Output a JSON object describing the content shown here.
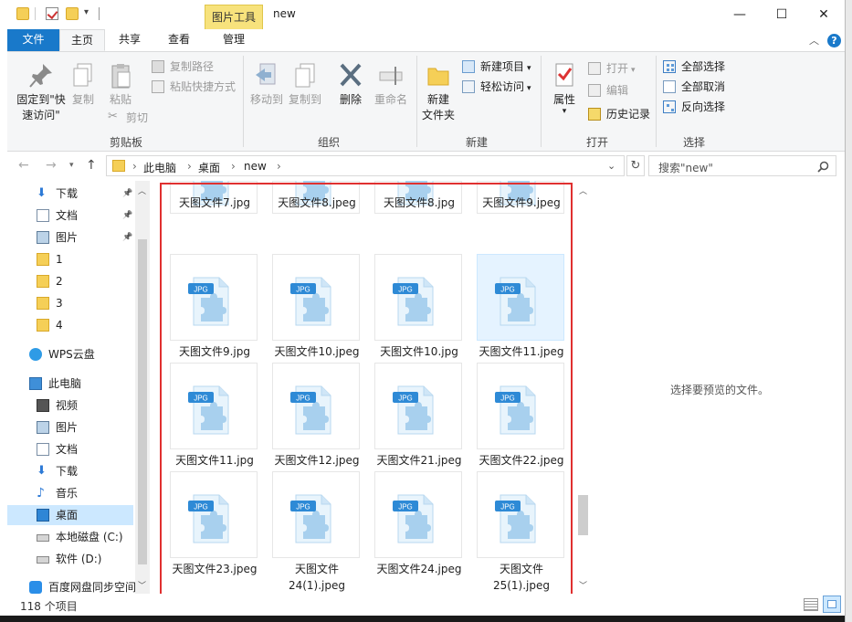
{
  "window": {
    "title": "new",
    "context_tab": "图片工具",
    "minimize": "—",
    "maximize": "☐",
    "close": "✕"
  },
  "tabs": {
    "file": "文件",
    "home": "主页",
    "share": "共享",
    "view": "查看",
    "manage": "管理"
  },
  "ribbon": {
    "pin_quick": "固定到\"快",
    "pin_quick2": "速访问\"",
    "copy": "复制",
    "paste": "粘贴",
    "copy_path": "复制路径",
    "paste_shortcut": "粘贴快捷方式",
    "cut": "剪切",
    "clipboard_label": "剪贴板",
    "move_to": "移动到",
    "copy_to": "复制到",
    "delete": "删除",
    "rename": "重命名",
    "organize_label": "组织",
    "new_folder": "新建",
    "new_folder2": "文件夹",
    "new_item": "新建项目",
    "easy_access": "轻松访问",
    "new_label": "新建",
    "properties": "属性",
    "open": "打开",
    "edit": "编辑",
    "history": "历史记录",
    "open_label": "打开",
    "select_all": "全部选择",
    "select_none": "全部取消",
    "invert": "反向选择",
    "select_label": "选择"
  },
  "address": {
    "crumb1": "此电脑",
    "crumb2": "桌面",
    "crumb3": "new",
    "search_placeholder": "搜索\"new\""
  },
  "nav": {
    "items": [
      {
        "label": "下载",
        "icon": "download-icon"
      },
      {
        "label": "文档",
        "icon": "document-icon"
      },
      {
        "label": "图片",
        "icon": "picture-icon"
      },
      {
        "label": "1",
        "icon": "folder-icon"
      },
      {
        "label": "2",
        "icon": "folder-icon"
      },
      {
        "label": "3",
        "icon": "folder-icon"
      },
      {
        "label": "4",
        "icon": "folder-icon"
      },
      {
        "label": "WPS云盘",
        "icon": "cloud-icon"
      },
      {
        "label": "此电脑",
        "icon": "computer-icon"
      },
      {
        "label": "视频",
        "icon": "video-icon"
      },
      {
        "label": "图片",
        "icon": "picture-icon"
      },
      {
        "label": "文档",
        "icon": "document-icon"
      },
      {
        "label": "下载",
        "icon": "download-icon"
      },
      {
        "label": "音乐",
        "icon": "music-icon"
      },
      {
        "label": "桌面",
        "icon": "desktop-icon"
      },
      {
        "label": "本地磁盘 (C:)",
        "icon": "drive-icon"
      },
      {
        "label": "软件 (D:)",
        "icon": "drive-icon"
      },
      {
        "label": "百度网盘同步空间",
        "icon": "baidu-icon"
      }
    ]
  },
  "files": [
    {
      "name": "天图文件7.jpg"
    },
    {
      "name": "天图文件8.jpeg"
    },
    {
      "name": "天图文件8.jpg"
    },
    {
      "name": "天图文件9.jpeg"
    },
    {
      "name": "天图文件9.jpg"
    },
    {
      "name": "天图文件10.jpeg"
    },
    {
      "name": "天图文件10.jpg"
    },
    {
      "name": "天图文件11.jpeg"
    },
    {
      "name": "天图文件11.jpg"
    },
    {
      "name": "天图文件12.jpeg"
    },
    {
      "name": "天图文件21.jpeg"
    },
    {
      "name": "天图文件22.jpeg"
    },
    {
      "name": "天图文件23.jpeg"
    },
    {
      "name": "天图文件",
      "name2": "24(1).jpeg"
    },
    {
      "name": "天图文件24.jpeg"
    },
    {
      "name": "天图文件",
      "name2": "25(1).jpeg"
    }
  ],
  "jpg_badge": "JPG",
  "preview": {
    "message": "选择要预览的文件。"
  },
  "status": {
    "count": "118 个项目"
  },
  "colors": {
    "accent": "#1979ca",
    "selection": "#cce8ff",
    "highlight_box": "#e03030",
    "context_tab": "#f7e27c"
  }
}
